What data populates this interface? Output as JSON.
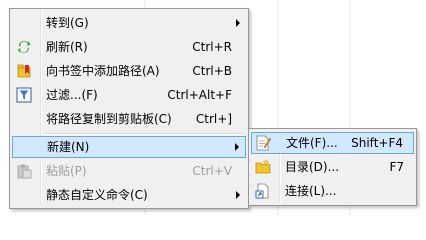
{
  "main_menu": {
    "items": [
      {
        "label": "转到(G)",
        "shortcut": "",
        "submenu": true,
        "icon": "none"
      },
      {
        "label": "刷新(R)",
        "shortcut": "Ctrl+R",
        "submenu": false,
        "icon": "refresh-icon"
      },
      {
        "label": "向书签中添加路径(A)",
        "shortcut": "Ctrl+B",
        "submenu": false,
        "icon": "bookmark-add-icon"
      },
      {
        "label": "过滤...(F)",
        "shortcut": "Ctrl+Alt+F",
        "submenu": false,
        "icon": "filter-icon"
      },
      {
        "label": "将路径复制到剪贴板(C)",
        "shortcut": "Ctrl+]",
        "submenu": false,
        "icon": "none"
      },
      {
        "label": "新建(N)",
        "shortcut": "",
        "submenu": true,
        "icon": "none",
        "highlighted": true
      },
      {
        "label": "粘贴(P)",
        "shortcut": "Ctrl+V",
        "submenu": false,
        "icon": "paste-icon",
        "disabled": true
      },
      {
        "label": "静态自定义命令(C)",
        "shortcut": "",
        "submenu": true,
        "icon": "none"
      }
    ]
  },
  "sub_menu": {
    "items": [
      {
        "label": "文件(F)...",
        "shortcut": "Shift+F4",
        "icon": "new-file-icon",
        "highlighted": true
      },
      {
        "label": "目录(D)...",
        "shortcut": "F7",
        "icon": "new-folder-icon"
      },
      {
        "label": "连接(L)...",
        "shortcut": "",
        "icon": "new-link-icon"
      }
    ]
  },
  "colors": {
    "menu_bg": "#f0f0f0",
    "highlight_bg": "#d1e8ff",
    "highlight_border": "#66a7e8",
    "disabled_text": "#a0a0a0"
  }
}
